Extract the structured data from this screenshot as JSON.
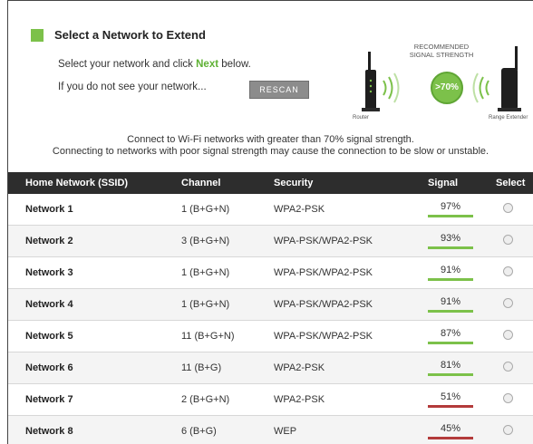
{
  "header": {
    "title": "Select a Network to Extend",
    "instruction_prefix": "Select your network and click ",
    "instruction_next": "Next",
    "instruction_suffix": " below.",
    "not_seen_text": "If you do not see your network...",
    "rescan_label": "RESCAN"
  },
  "graphic": {
    "recommended_line1": "RECOMMENDED",
    "recommended_line2": "SIGNAL STRENGTH",
    "badge": ">70%",
    "router_label": "Router",
    "extender_label": "Range Extender"
  },
  "info": {
    "line1": "Connect to Wi-Fi networks with greater than 70% signal strength.",
    "line2": "Connecting to networks with poor signal strength may cause the connection to be slow or unstable."
  },
  "table": {
    "headers": [
      "Home Network (SSID)",
      "Channel",
      "Security",
      "Signal",
      "Select"
    ],
    "rows": [
      {
        "ssid": "Network 1",
        "channel": "1 (B+G+N)",
        "security": "WPA2-PSK",
        "signal": "97%",
        "level": 0.97,
        "bar_color": "#7cc14a"
      },
      {
        "ssid": "Network 2",
        "channel": "3 (B+G+N)",
        "security": "WPA-PSK/WPA2-PSK",
        "signal": "93%",
        "level": 0.93,
        "bar_color": "#7cc14a"
      },
      {
        "ssid": "Network 3",
        "channel": "1 (B+G+N)",
        "security": "WPA-PSK/WPA2-PSK",
        "signal": "91%",
        "level": 0.91,
        "bar_color": "#7cc14a"
      },
      {
        "ssid": "Network 4",
        "channel": "1 (B+G+N)",
        "security": "WPA-PSK/WPA2-PSK",
        "signal": "91%",
        "level": 0.91,
        "bar_color": "#7cc14a"
      },
      {
        "ssid": "Network 5",
        "channel": "11 (B+G+N)",
        "security": "WPA-PSK/WPA2-PSK",
        "signal": "87%",
        "level": 0.87,
        "bar_color": "#7cc14a"
      },
      {
        "ssid": "Network 6",
        "channel": "11 (B+G)",
        "security": "WPA2-PSK",
        "signal": "81%",
        "level": 0.81,
        "bar_color": "#7cc14a"
      },
      {
        "ssid": "Network 7",
        "channel": "2 (B+G+N)",
        "security": "WPA2-PSK",
        "signal": "51%",
        "level": 0.51,
        "bar_color": "#b33b3b"
      },
      {
        "ssid": "Network 8",
        "channel": "6 (B+G)",
        "security": "WEP",
        "signal": "45%",
        "level": 0.45,
        "bar_color": "#b33b3b"
      }
    ]
  }
}
